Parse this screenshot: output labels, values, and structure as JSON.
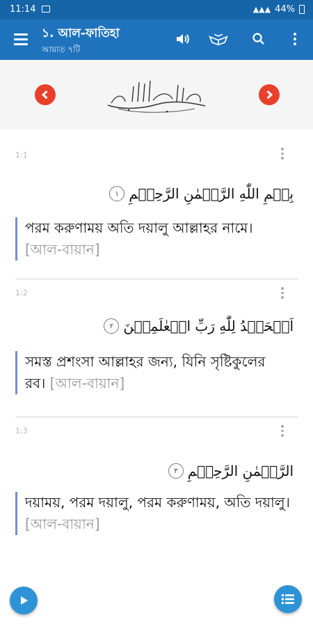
{
  "status_bar": {
    "time": "11:14",
    "battery": "44%"
  },
  "app_bar": {
    "title": "১. আল-ফাতিহা",
    "subtitle": "আয়াত ৭টি"
  },
  "verses": [
    {
      "number": "1:1",
      "arabic": "بِسۡمِ اللّٰهِ الرَّحۡمٰنِ الرَّحِیۡمِ",
      "ayah": "١",
      "translation": "পরম করুণাময় অতি দয়ালু আল্লাহর নামে।",
      "source": "[আল-বায়ান]"
    },
    {
      "number": "1:2",
      "arabic": "اَلۡحَمۡدُ لِلّٰهِ رَبِّ الۡعٰلَمِیۡنَ",
      "ayah": "٢",
      "translation": "সমস্ত প্রশংসা আল্লাহর জন্য, যিনি সৃষ্টিকুলের রব।",
      "source": "[আল-বায়ান]"
    },
    {
      "number": "1:3",
      "arabic": "الرَّحۡمٰنِ الرَّحِیۡمِ",
      "ayah": "٣",
      "translation": "দয়াময়, পরম দয়ালু, পরম করুণাময়, অতি দয়ালু।",
      "source": "[আল-বায়ান]"
    }
  ],
  "colors": {
    "app_bar": "#1f73bc",
    "status_bar": "#1565a8",
    "nav_button": "#e8402b",
    "fab": "#2d93d6",
    "verse_border": "#6f8fd0"
  },
  "icons": {
    "menu": "menu-icon",
    "audio": "speaker-icon",
    "quran": "quran-book-icon",
    "search": "search-icon",
    "more": "more-vert-icon",
    "prev": "chevron-left-icon",
    "next": "chevron-right-icon",
    "play": "play-icon",
    "list": "list-icon"
  }
}
